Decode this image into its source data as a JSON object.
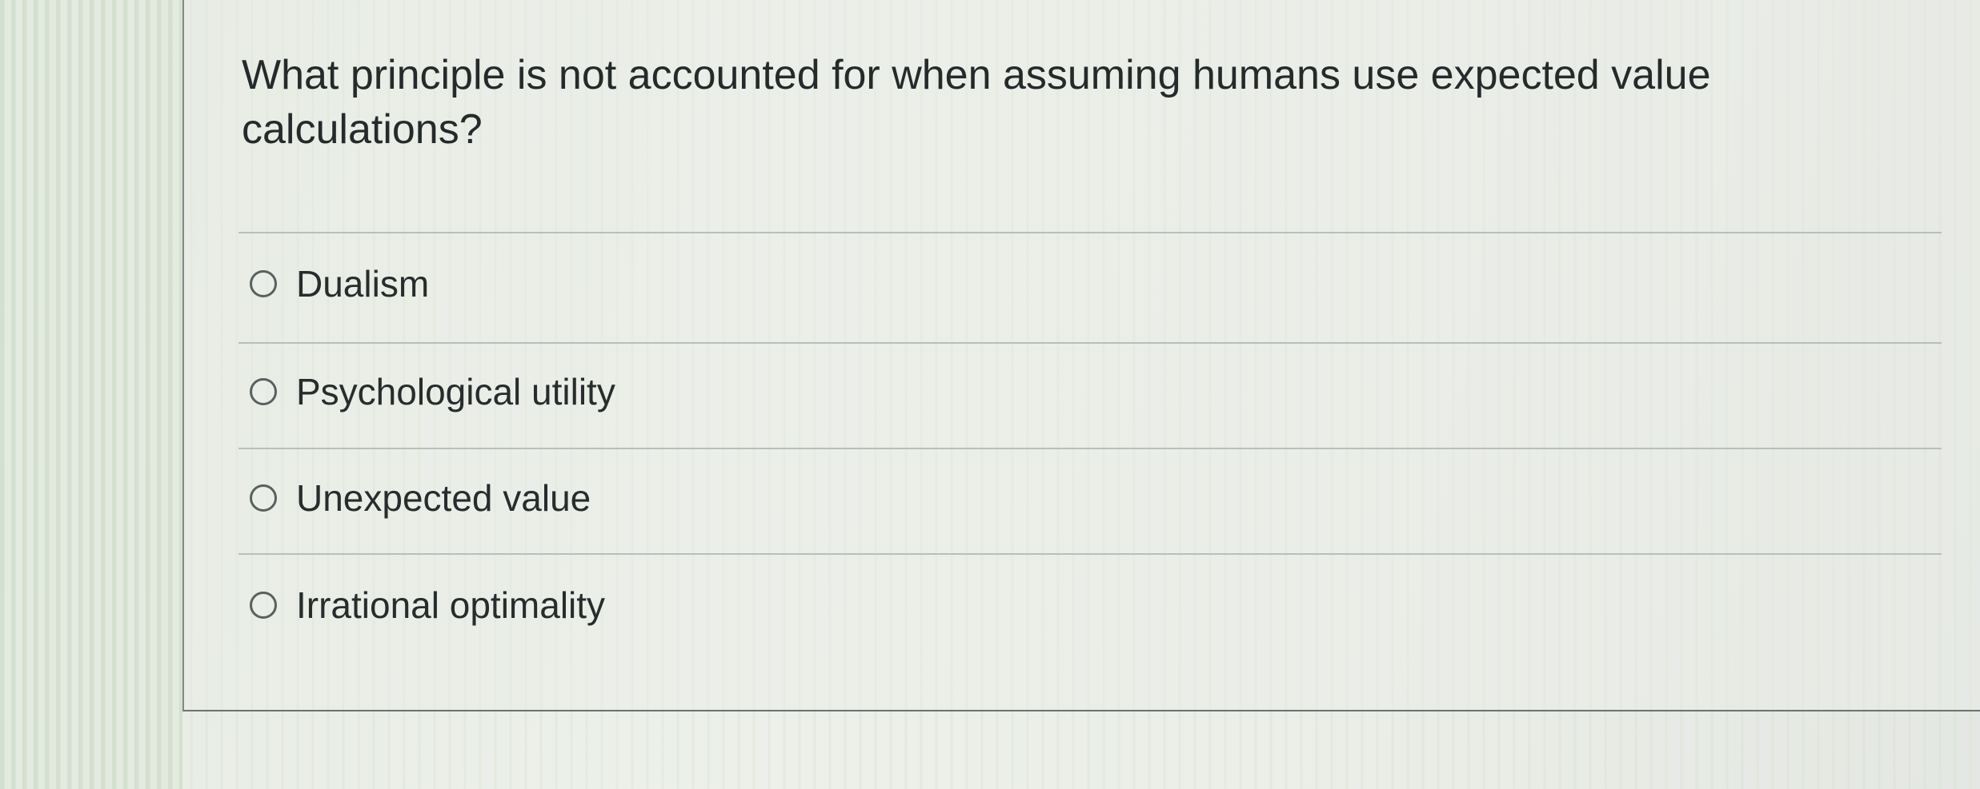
{
  "question": {
    "text": "What principle is not accounted for when assuming humans use expected value calculations?"
  },
  "options": [
    {
      "label": "Dualism",
      "selected": false
    },
    {
      "label": "Psychological utility",
      "selected": false
    },
    {
      "label": "Unexpected value",
      "selected": false
    },
    {
      "label": "Irrational optimality",
      "selected": false
    }
  ]
}
